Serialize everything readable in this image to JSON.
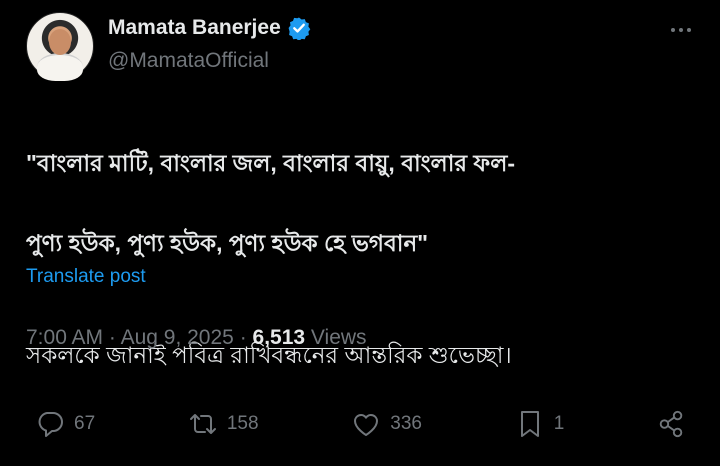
{
  "author": {
    "name": "Mamata Banerjee",
    "handle": "@MamataOfficial",
    "verified_color": "#1d9bf0"
  },
  "post": {
    "line1": "\"বাংলার মাটি, বাংলার জল, বাংলার বায়ু, বাংলার ফল-",
    "line2": "পুণ্য হউক, পুণ্য হউক, পুণ্য হউক হে ভগবান\"",
    "line3": "সকলকে জানাই পবিত্র রাখিবন্ধনের আন্তরিক শুভেচ্ছা।",
    "translate_label": "Translate post"
  },
  "meta": {
    "time": "7:00 AM",
    "date": "Aug 9, 2025",
    "views_count": "6,513",
    "views_label": "Views"
  },
  "actions": {
    "replies": "67",
    "reposts": "158",
    "likes": "336",
    "bookmarks": "1"
  },
  "icons": [
    "verified-badge-icon",
    "more-icon",
    "reply-icon",
    "repost-icon",
    "like-icon",
    "bookmark-icon",
    "share-icon"
  ]
}
